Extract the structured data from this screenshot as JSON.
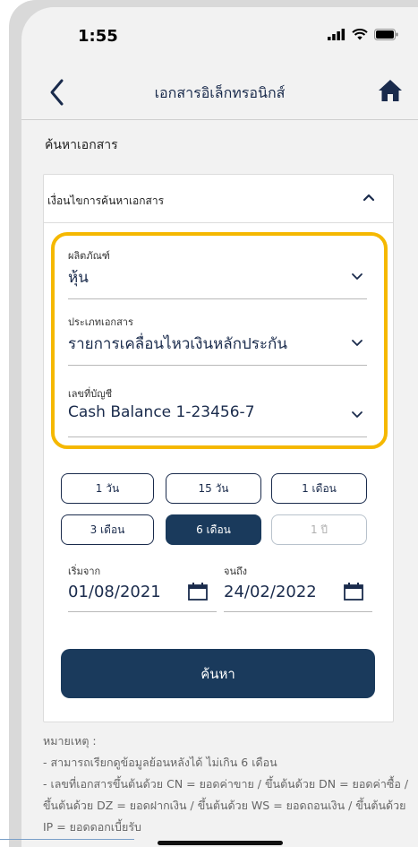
{
  "status_bar": {
    "time": "1:55"
  },
  "nav": {
    "title": "เอกสารอิเล็กทรอนิกส์"
  },
  "section_title": "ค้นหาเอกสาร",
  "criteria": {
    "header_label": "เงื่อนไขการค้นหาเอกสาร",
    "product": {
      "label": "ผลิตภัณฑ์",
      "value": "หุ้น"
    },
    "doc_type": {
      "label": "ประเภทเอกสาร",
      "value": "รายการเคลื่อนไหวเงินหลักประกัน"
    },
    "account": {
      "label": "เลขที่บัญชี",
      "value": "Cash Balance 1-23456-7"
    }
  },
  "periods": [
    {
      "label": "1 วัน",
      "state": "normal"
    },
    {
      "label": "15 วัน",
      "state": "normal"
    },
    {
      "label": "1 เดือน",
      "state": "normal"
    },
    {
      "label": "3 เดือน",
      "state": "normal"
    },
    {
      "label": "6 เดือน",
      "state": "selected"
    },
    {
      "label": "1 ปี",
      "state": "disabled"
    }
  ],
  "date_range": {
    "start": {
      "label": "เริ่มจาก",
      "value": "01/08/2021"
    },
    "end": {
      "label": "จนถึง",
      "value": "24/02/2022"
    }
  },
  "search_label": "ค้นหา",
  "notes": {
    "heading": "หมายเหตุ :",
    "line1": "- สามารถเรียกดูข้อมูลย้อนหลังได้ ไม่เกิน 6 เดือน",
    "line2": "- เลขที่เอกสารขึ้นต้นด้วย CN = ยอดค่าขาย / ขึ้นต้นด้วย DN = ยอดค่าซื้อ / ขึ้นต้นด้วย DZ = ยอดฝากเงิน / ขึ้นต้นด้วย WS = ยอดถอนเงิน / ขึ้นต้นด้วย IP = ยอดดอกเบี้ยรับ"
  },
  "colors": {
    "primary": "#1a3a5c",
    "highlight": "#f5b800",
    "background": "#f2f2f2"
  },
  "icons": [
    "back-arrow-icon",
    "home-icon",
    "chevron-up-icon",
    "chevron-down-icon",
    "calendar-icon",
    "signal-icon",
    "wifi-icon",
    "battery-icon"
  ]
}
